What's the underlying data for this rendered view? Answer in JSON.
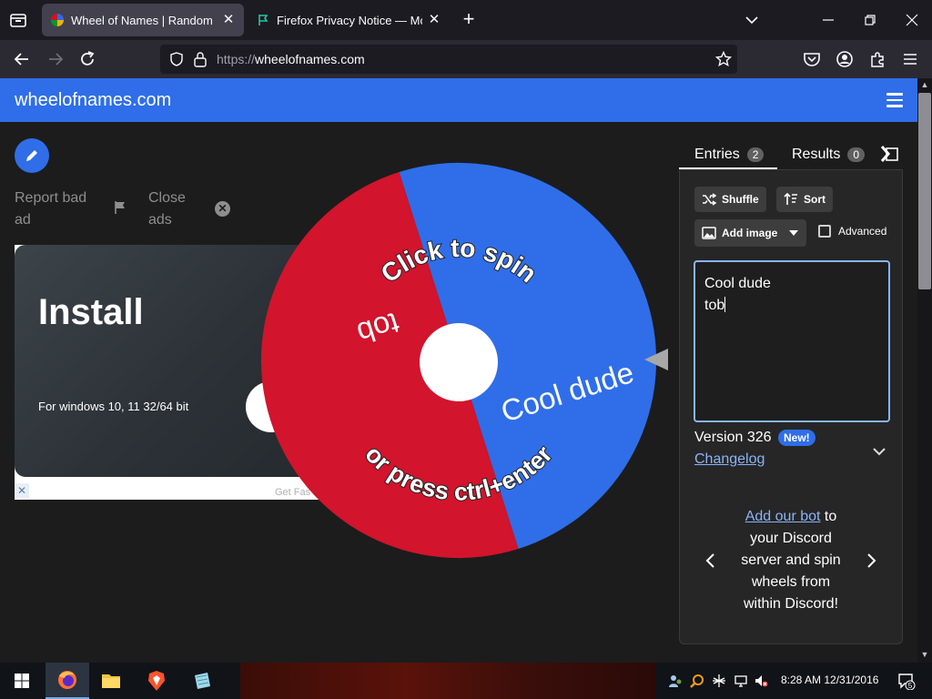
{
  "browser": {
    "tabs": [
      {
        "title": "Wheel of Names | Random nam",
        "active": true
      },
      {
        "title": "Firefox Privacy Notice — Mozill",
        "active": false
      }
    ],
    "url_scheme": "https://",
    "url_host": "wheelofnames.com"
  },
  "site": {
    "title": "wheelofnames.com"
  },
  "ads": {
    "report_label": "Report bad ad",
    "close_label": "Close ads",
    "ad_title": "Install",
    "ad_subtitle": "For windows 10, 11 32/64 bit",
    "ad_footer": "Get Fas"
  },
  "wheel": {
    "entries": [
      "Cool dude",
      "tob"
    ],
    "colors": [
      "#2f6ee8",
      "#d2142c"
    ],
    "prompt_top": "Click to spin",
    "prompt_bottom": "or press ctrl+enter"
  },
  "panel": {
    "tabs": [
      {
        "label": "Entries",
        "count": "2"
      },
      {
        "label": "Results",
        "count": "0"
      }
    ],
    "shuffle_label": "Shuffle",
    "sort_label": "Sort",
    "add_image_label": "Add image",
    "advanced_label": "Advanced",
    "entries_text": [
      "Cool dude",
      "tob"
    ],
    "version_label": "Version 326",
    "new_badge": "New!",
    "changelog_label": "Changelog",
    "discord_link": "Add our bot",
    "discord_text": " to your Discord server and spin wheels from within Discord!"
  },
  "taskbar": {
    "time": "8:28 AM",
    "date": "12/31/2016",
    "notification_count": "5"
  }
}
